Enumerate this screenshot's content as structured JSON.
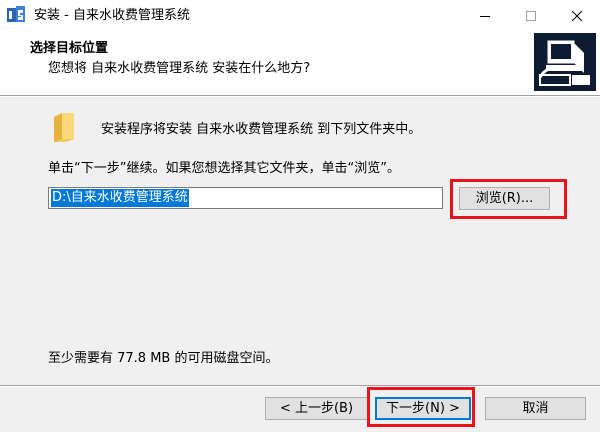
{
  "window": {
    "title": "安装 - 自来水收费管理系统",
    "icon": "installer-app-icon",
    "controls": [
      "minimize-icon",
      "maximize-icon",
      "close-icon"
    ]
  },
  "header": {
    "title": "选择目标位置",
    "subtitle": "您想将 自来水收费管理系统 安装在什么地方?",
    "image": "computer-install-icon"
  },
  "main": {
    "folder_icon": "folder-icon",
    "info_text": "安装程序将安装 自来水收费管理系统 到下列文件夹中。",
    "instruction": "单击“下一步”继续。如果您想选择其它文件夹，单击“浏览”。",
    "path_value": "D:\\自来水收费管理系统",
    "browse_label": "浏览(R)...",
    "disk_space": "至少需要有 77.8 MB 的可用磁盘空间。"
  },
  "footer": {
    "back_label": "< 上一步(B)",
    "next_label": "下一步(N) >",
    "cancel_label": "取消"
  },
  "colors": {
    "highlight_box": "#e8141c",
    "selection": "#0078d7",
    "panel_bg": "#f0f0f0"
  }
}
